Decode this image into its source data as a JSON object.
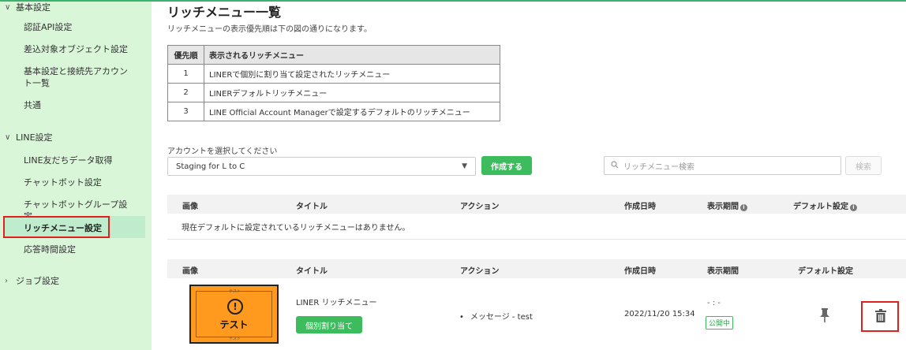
{
  "sidebar": {
    "sections": [
      {
        "label": "基本設定",
        "state": "expanded"
      },
      {
        "label": "LINE設定",
        "state": "expanded"
      },
      {
        "label": "ジョブ設定",
        "state": "collapsed"
      }
    ],
    "basic_items": [
      "認証API設定",
      "差込対象オブジェクト設定",
      "基本設定と接続先アカウント一覧",
      "共通"
    ],
    "line_items": [
      "LINE友だちデータ取得",
      "チャットボット設定",
      "チャットボットグループ設定",
      "リッチメニュー設定",
      "応答時間設定"
    ],
    "active_item": "リッチメニュー設定"
  },
  "main": {
    "title": "リッチメニュー一覧",
    "description": "リッチメニューの表示優先順は下の図の通りになります。",
    "priority_table": {
      "headers": [
        "優先順",
        "表示されるリッチメニュー"
      ],
      "rows": [
        [
          "1",
          "LINERで個別に割り当て設定されたリッチメニュー"
        ],
        [
          "2",
          "LINERデフォルトリッチメニュー"
        ],
        [
          "3",
          "LINE Official Account Managerで設定するデフォルトのリッチメニュー"
        ]
      ]
    },
    "account": {
      "label": "アカウントを選択してください",
      "selected": "Staging for L to C",
      "create_button": "作成する"
    },
    "search": {
      "placeholder": "リッチメニュー検索",
      "button": "検索"
    },
    "columns": {
      "image": "画像",
      "title": "タイトル",
      "action": "アクション",
      "created": "作成日時",
      "period": "表示期間",
      "default": "デフォルト設定"
    },
    "default_table_empty": "現在デフォルトに設定されているリッチメニューはありません。",
    "menu_rows": [
      {
        "thumbnail_text": "テスト",
        "thumbnail_small_text": "テスト",
        "title": "LINER リッチメニュー",
        "assign_button": "個別割り当て",
        "action": "メッセージ - test",
        "created": "2022/11/20 15:34",
        "period": "- : -",
        "status": "公開中"
      }
    ]
  },
  "colors": {
    "accent_green": "#3dbc5e",
    "sidebar_bg": "#d9f6d9",
    "highlight_red": "#e0201c",
    "thumbnail_orange": "#ff9a1f"
  }
}
